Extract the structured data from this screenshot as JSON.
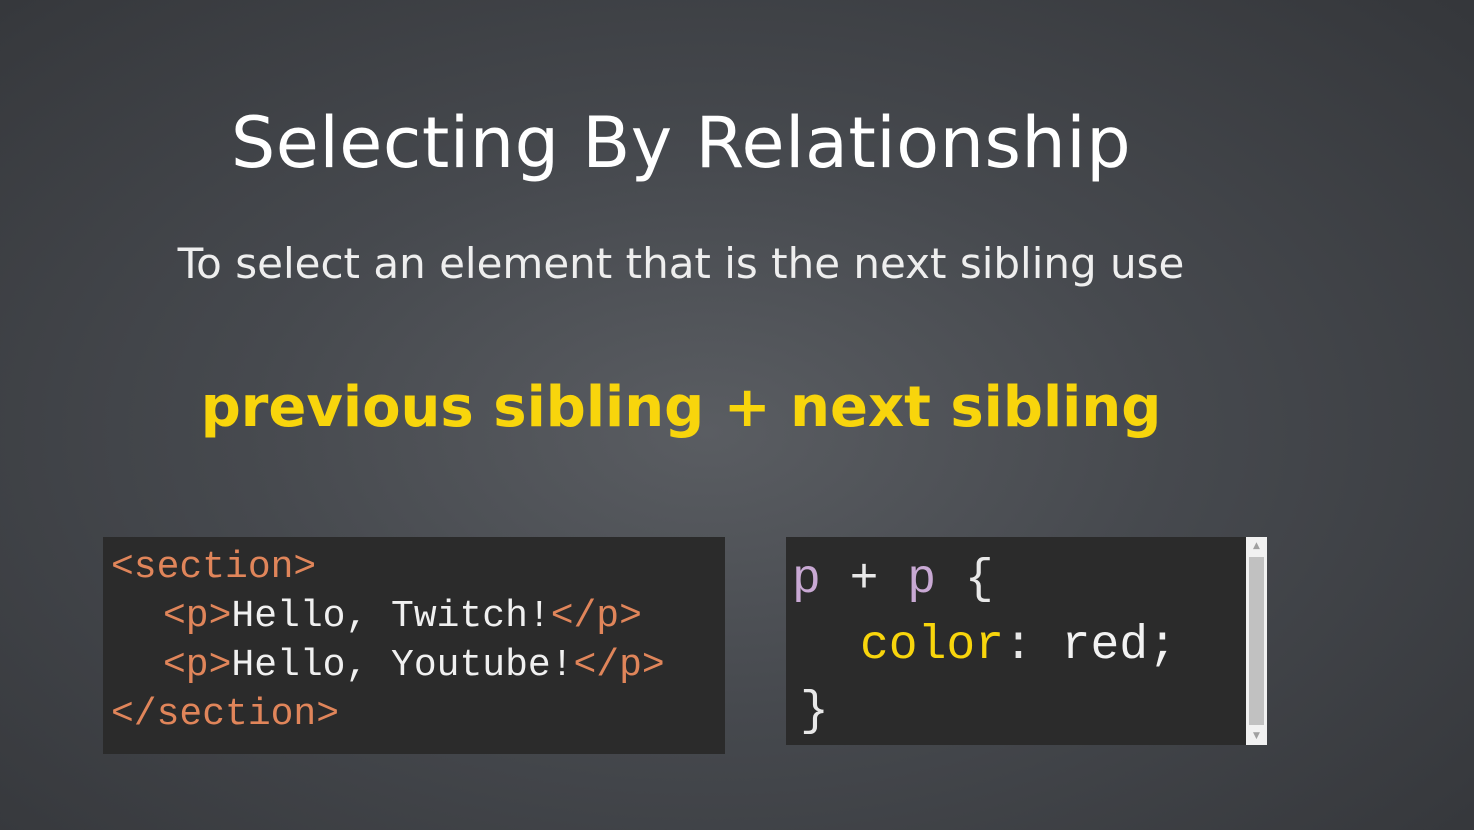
{
  "slide": {
    "title": "Selecting By Relationship",
    "subtitle": "To select an element that is the next sibling use",
    "highlight": "previous sibling + next sibling"
  },
  "html_example": {
    "line1_tag": "<section>",
    "line2_open": "<p>",
    "line2_text": "Hello, Twitch!",
    "line2_close": "</p>",
    "line3_open": "<p>",
    "line3_text": "Hello, Youtube!",
    "line3_close": "</p>",
    "line4_tag": "</section>"
  },
  "css_example": {
    "selector_left": "p",
    "combinator": " + ",
    "selector_right": "p",
    "open_brace": " {",
    "property": "color",
    "colon": ": ",
    "value": "red;",
    "close_brace": "}"
  },
  "scrollbar": {
    "up_arrow": "▲",
    "down_arrow": "▼"
  },
  "colors": {
    "background": "#46494e",
    "highlight": "#f8d50c",
    "code_background": "#2b2b2b",
    "tag": "#e0855a",
    "selector": "#c9a9d4"
  }
}
